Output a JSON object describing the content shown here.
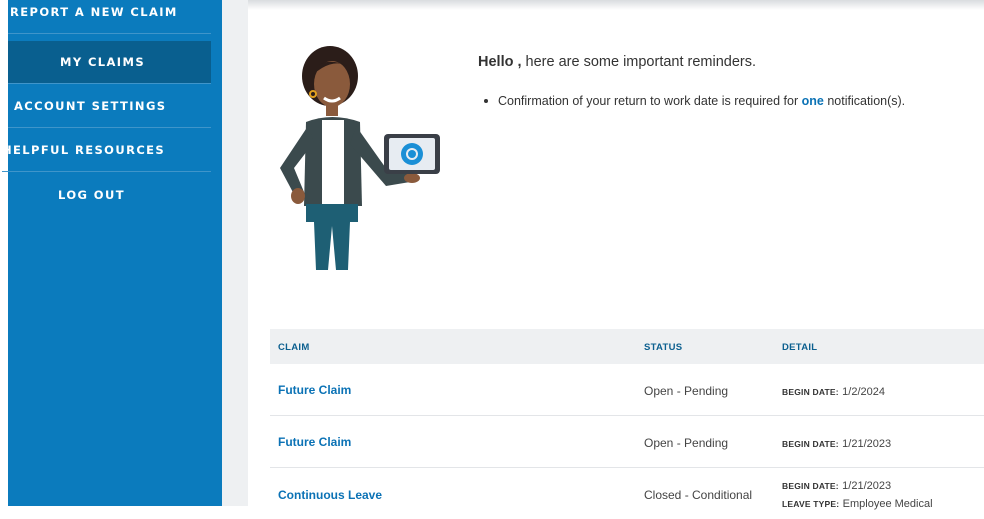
{
  "sidebar": {
    "items": [
      {
        "label": "REPORT A NEW CLAIM"
      },
      {
        "label": "MY CLAIMS"
      },
      {
        "label": "ACCOUNT SETTINGS"
      },
      {
        "label": "HELPFUL RESOURCES"
      },
      {
        "label": "LOG OUT"
      }
    ],
    "active_index": 1,
    "colors": {
      "bg": "#0b7bbd",
      "active": "#095f8f"
    }
  },
  "greeting": {
    "hello": "Hello ,",
    "rest": "here are some important reminders."
  },
  "reminders": [
    {
      "before": "Confirmation of your return to work date is required for",
      "link": "one",
      "after": "notification(s)."
    }
  ],
  "claims_table": {
    "headers": {
      "claim": "CLAIM",
      "status": "STATUS",
      "detail": "DETAIL"
    },
    "rows": [
      {
        "claim": "Future Claim",
        "status": "Open - Pending",
        "begin_label": "BEGIN DATE:",
        "begin_date": "1/2/2024"
      },
      {
        "claim": "Future Claim",
        "status": "Open - Pending",
        "begin_label": "BEGIN DATE:",
        "begin_date": "1/21/2023"
      },
      {
        "claim": "Continuous Leave",
        "status": "Closed - Conditional",
        "begin_label": "BEGIN DATE:",
        "begin_date": "1/21/2023",
        "leave_label": "LEAVE TYPE:",
        "leave_type": "Employee Medical"
      }
    ]
  },
  "colors": {
    "accent": "#0b72b5",
    "header_bg": "#eef0f2"
  }
}
